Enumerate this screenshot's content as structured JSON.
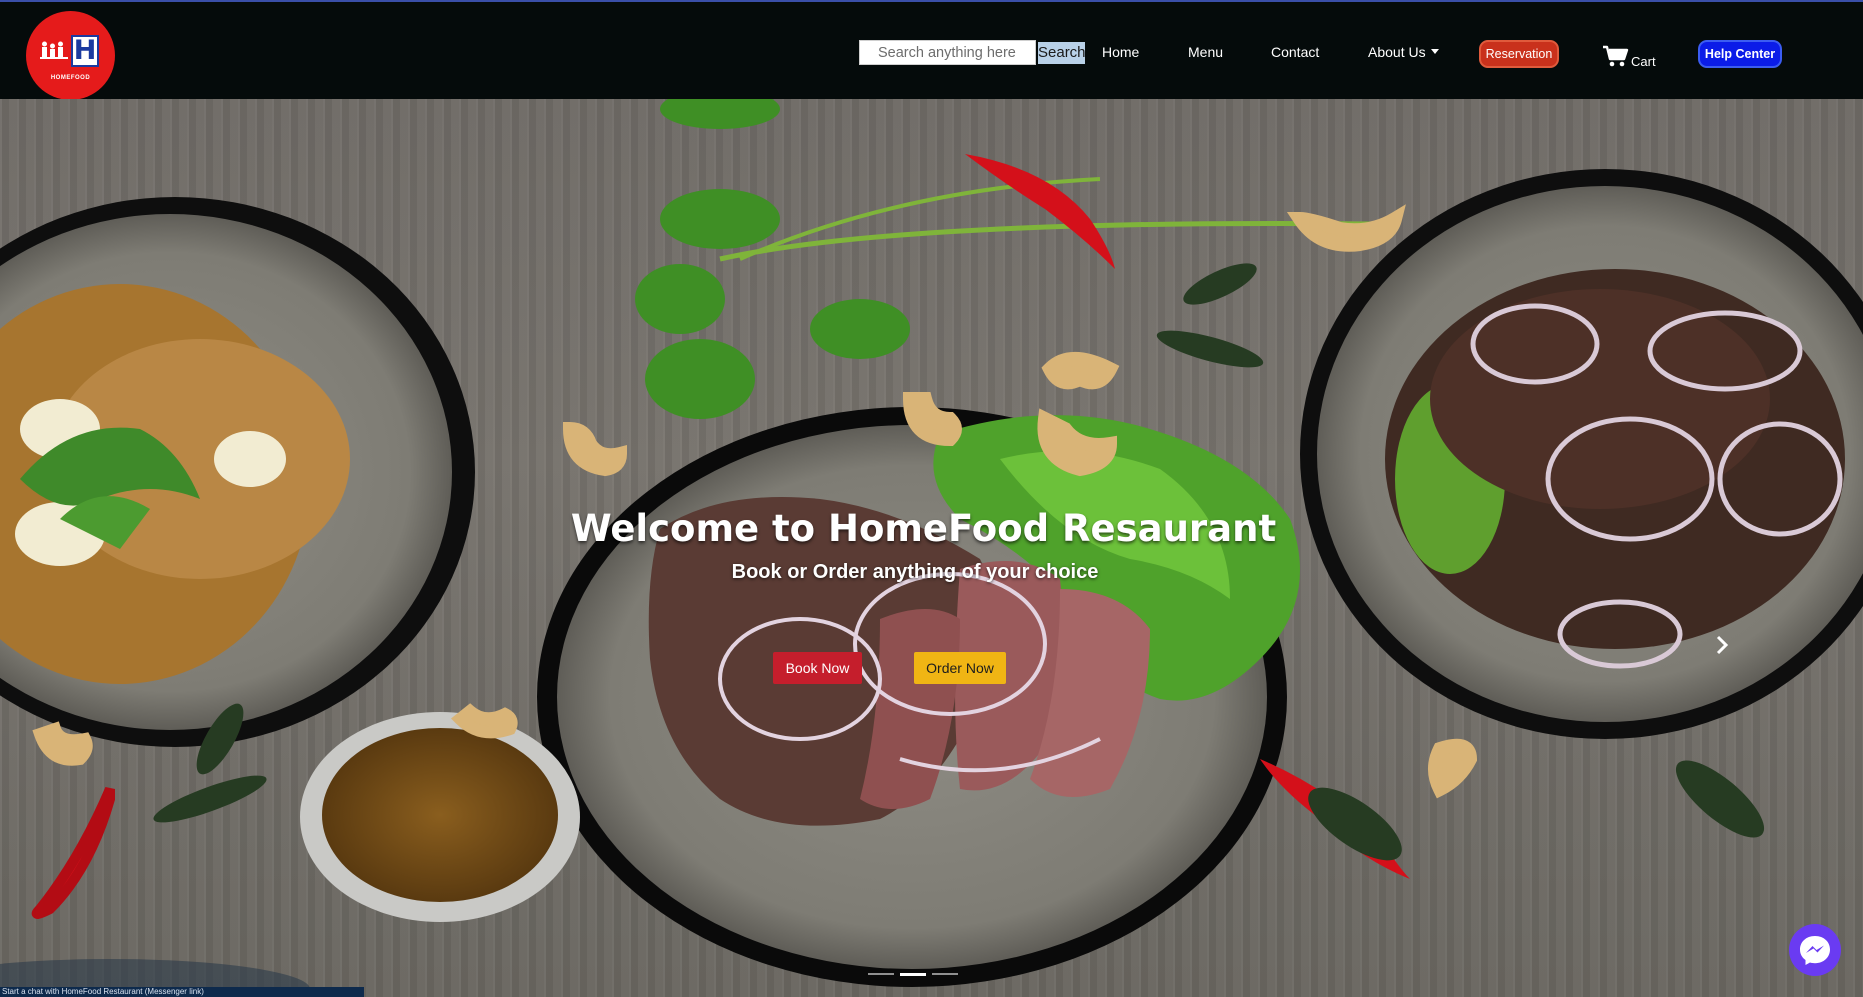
{
  "navbar": {
    "logo_text": "HOMEFOOD",
    "logo_letter": "H",
    "search": {
      "placeholder": "Search anything here",
      "button_label": "Search"
    },
    "links": {
      "home": "Home",
      "menu": "Menu",
      "contact": "Contact",
      "about": "About Us"
    },
    "reservation_label": "Reservation",
    "cart_label": "Cart",
    "help_label": "Help Center"
  },
  "hero": {
    "title": "Welcome to HomeFood Resaurant",
    "subtitle": "Book or Order anything of your choice",
    "book_label": "Book Now",
    "order_label": "Order Now",
    "slides": 3,
    "active_slide": 2
  },
  "status_bar": {
    "text": "Start a chat with HomeFood Restaurant (Messenger link)"
  },
  "icons": {
    "cart": "cart-icon",
    "next": "chevron-right-icon",
    "messenger": "messenger-icon"
  },
  "colors": {
    "nav_bg": "#050b0b",
    "reservation": "#c9311c",
    "help_center": "#0b1ce8",
    "book_now": "#c51e2c",
    "order_now": "#f0b514",
    "messenger": "#6a3bf2",
    "logo": "#e51b1b"
  }
}
